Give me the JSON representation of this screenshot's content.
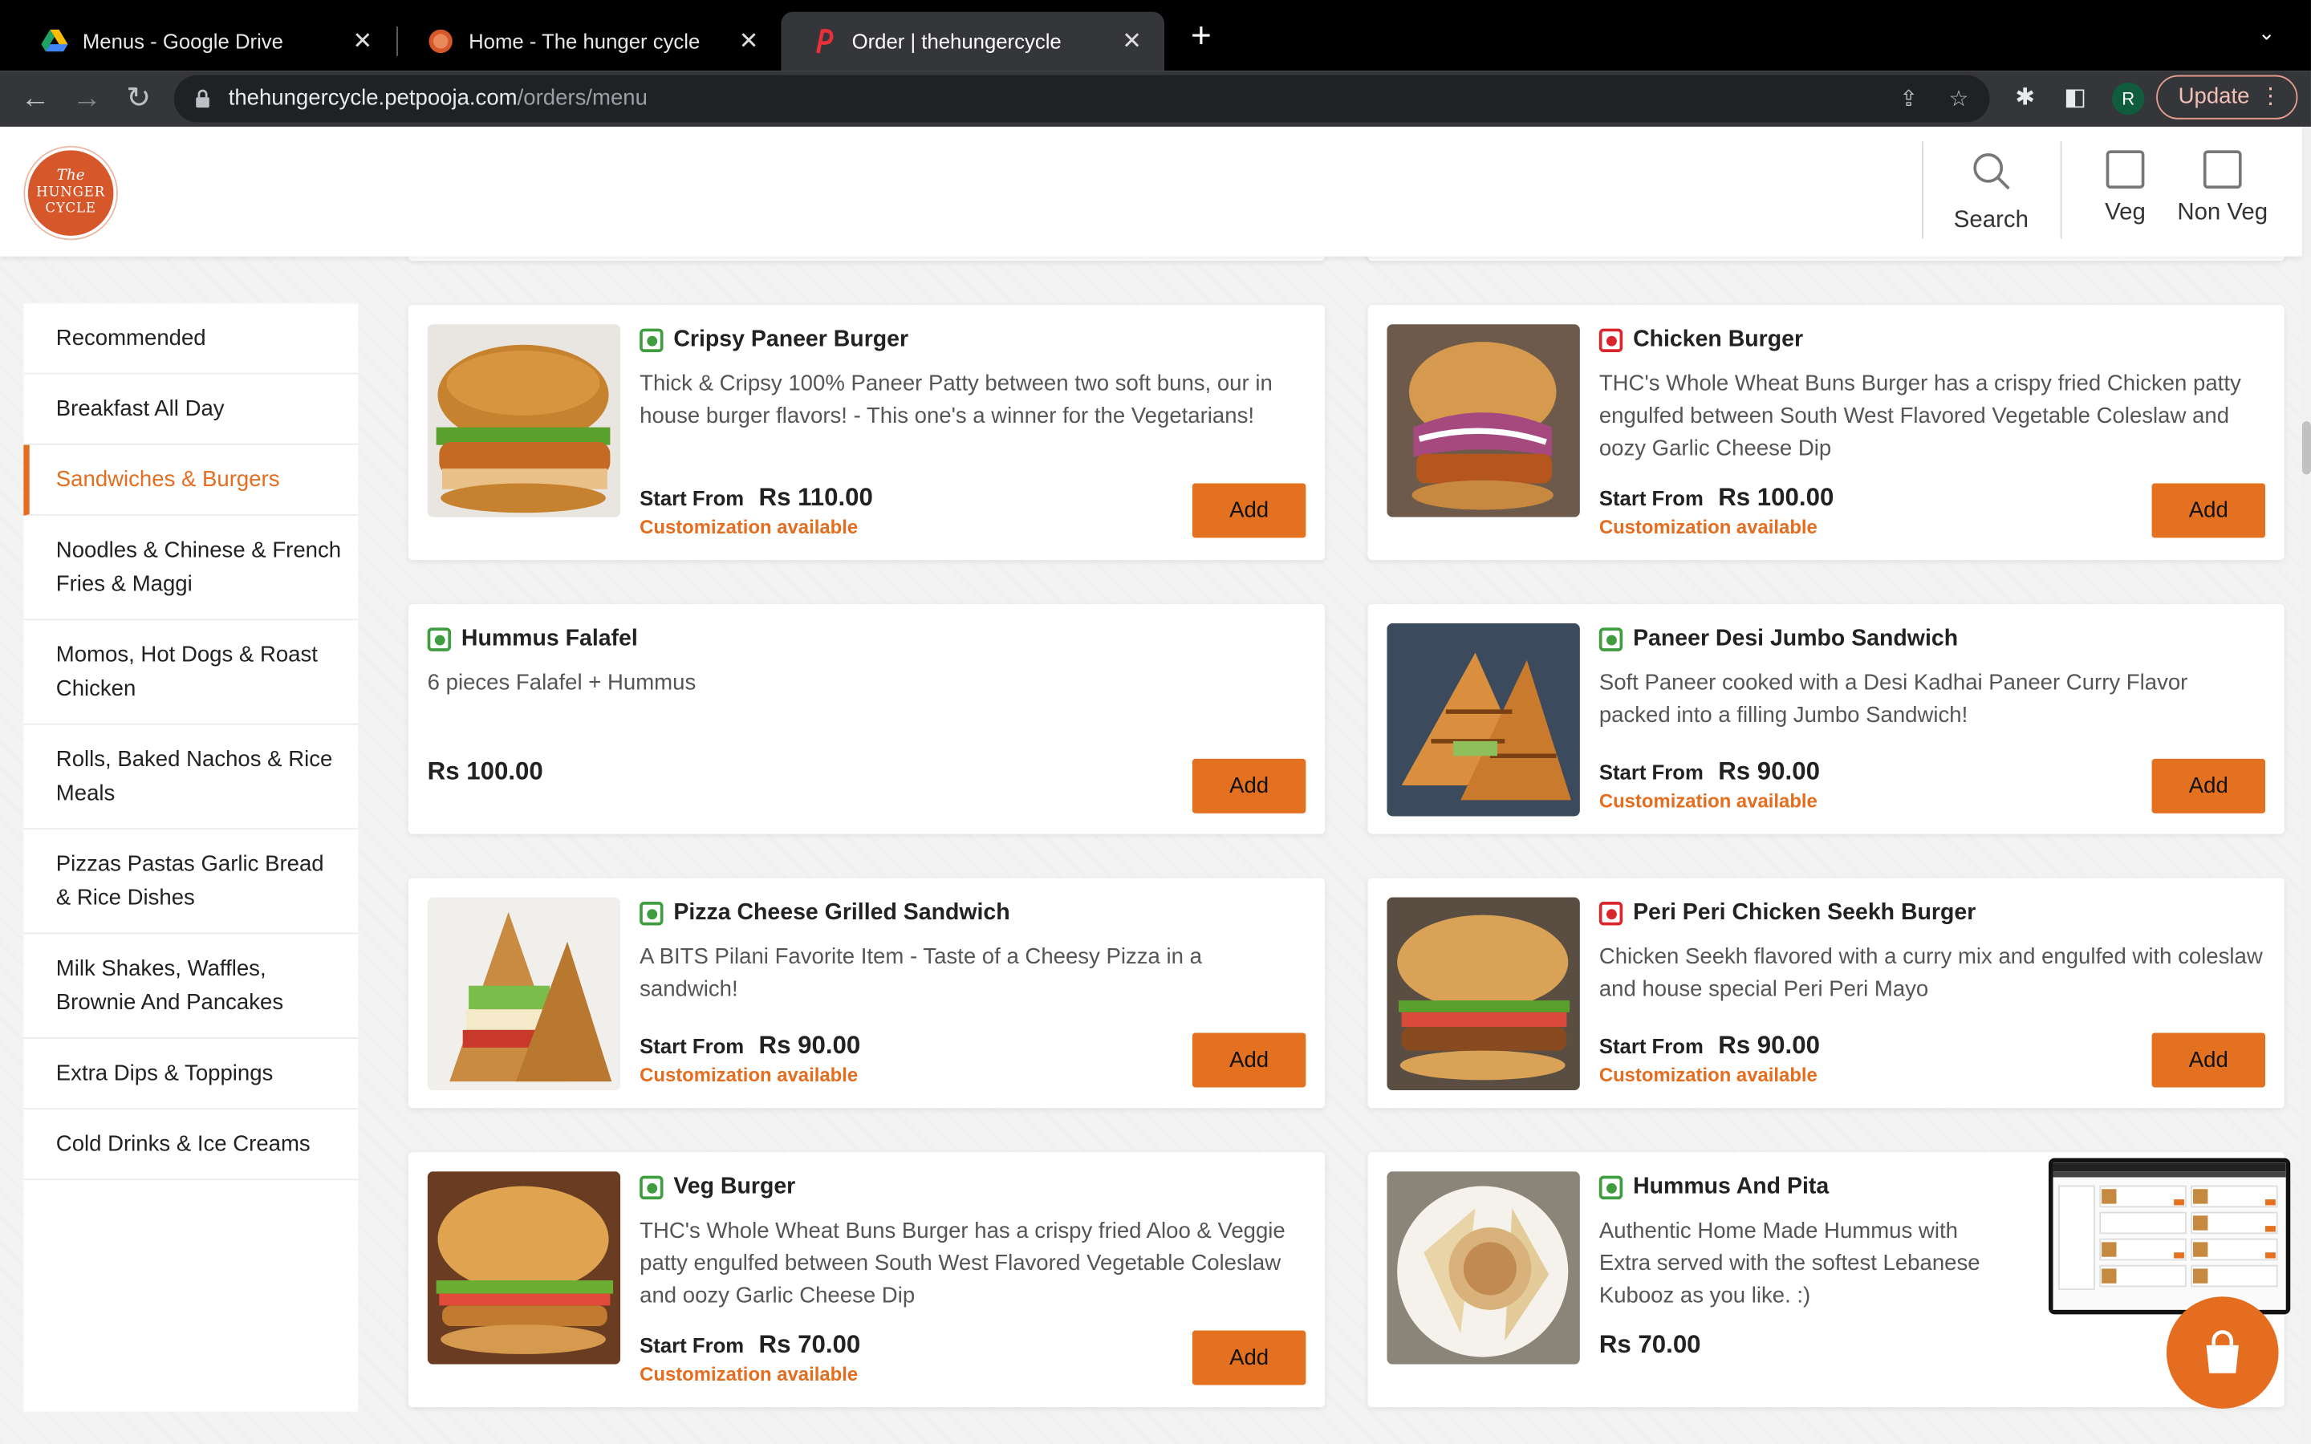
{
  "browser": {
    "tabs": [
      {
        "title": "Menus - Google Drive",
        "icon": "google-drive-icon"
      },
      {
        "title": "Home - The hunger cycle",
        "icon": "site-favicon"
      },
      {
        "title": "Order | thehungercycle",
        "icon": "petpooja-icon",
        "active": true
      }
    ],
    "url_host": "thehungercycle.petpooja.com",
    "url_path": "/orders/menu",
    "profile_initial": "R",
    "update_label": "Update"
  },
  "header": {
    "logo": {
      "line1": "The",
      "line2": "HUNGER",
      "line3": "CYCLE"
    },
    "search_label": "Search",
    "veg_label": "Veg",
    "nonveg_label": "Non Veg"
  },
  "sidebar": {
    "categories": [
      "Recommended",
      "Breakfast All Day",
      "Sandwiches & Burgers",
      "Noodles & Chinese & French Fries & Maggi",
      "Momos, Hot Dogs & Roast Chicken",
      "Rolls, Baked Nachos & Rice Meals",
      "Pizzas Pastas Garlic Bread & Rice Dishes",
      "Milk Shakes, Waffles, Brownie And Pancakes",
      "Extra Dips & Toppings",
      "Cold Drinks & Ice Creams"
    ],
    "active_index": 2
  },
  "labels": {
    "start_from": "Start From",
    "customization": "Customization available",
    "add": "Add"
  },
  "items": [
    {
      "name": "Cripsy Paneer Burger",
      "type": "veg",
      "desc": "Thick & Cripsy 100% Paneer Patty between two soft buns, our in house burger flavors! - This one's a winner for the Vegetarians!",
      "price": "Rs 110.00",
      "start_from": true,
      "customization": true
    },
    {
      "name": "Chicken Burger",
      "type": "nonveg",
      "desc": "THC's Whole Wheat Buns Burger has a crispy fried Chicken patty engulfed between South West Flavored Vegetable Coleslaw and oozy Garlic Cheese Dip",
      "price": "Rs 100.00",
      "start_from": true,
      "customization": true
    },
    {
      "name": "Hummus Falafel",
      "type": "veg",
      "desc": "6 pieces Falafel + Hummus",
      "price": "Rs 100.00",
      "start_from": false,
      "customization": false
    },
    {
      "name": "Paneer Desi Jumbo Sandwich",
      "type": "veg",
      "desc": "Soft Paneer cooked with a Desi Kadhai Paneer Curry Flavor packed into a filling Jumbo Sandwich!",
      "price": "Rs 90.00",
      "start_from": true,
      "customization": true
    },
    {
      "name": "Pizza Cheese Grilled Sandwich",
      "type": "veg",
      "desc": "A BITS Pilani Favorite Item - Taste of a Cheesy Pizza in a sandwich!",
      "price": "Rs 90.00",
      "start_from": true,
      "customization": true
    },
    {
      "name": "Peri Peri Chicken Seekh Burger",
      "type": "nonveg",
      "desc": "Chicken Seekh flavored with a curry mix and engulfed with coleslaw and house special Peri Peri Mayo",
      "price": "Rs 90.00",
      "start_from": true,
      "customization": true
    },
    {
      "name": "Veg Burger",
      "type": "veg",
      "desc": "THC's Whole Wheat Buns Burger has a crispy fried Aloo & Veggie patty engulfed between South West Flavored Vegetable Coleslaw and oozy Garlic Cheese Dip",
      "price": "Rs 70.00",
      "start_from": true,
      "customization": true
    },
    {
      "name": "Hummus And Pita",
      "type": "veg",
      "desc": "Authentic Home Made Hummus with Extra served with the softest Lebanese Kubooz as you like. :)",
      "price": "Rs 70.00",
      "start_from": false,
      "customization": false
    }
  ],
  "colors": {
    "accent": "#e4711f",
    "veg": "#3f9c3f",
    "nonveg": "#d9262c"
  }
}
